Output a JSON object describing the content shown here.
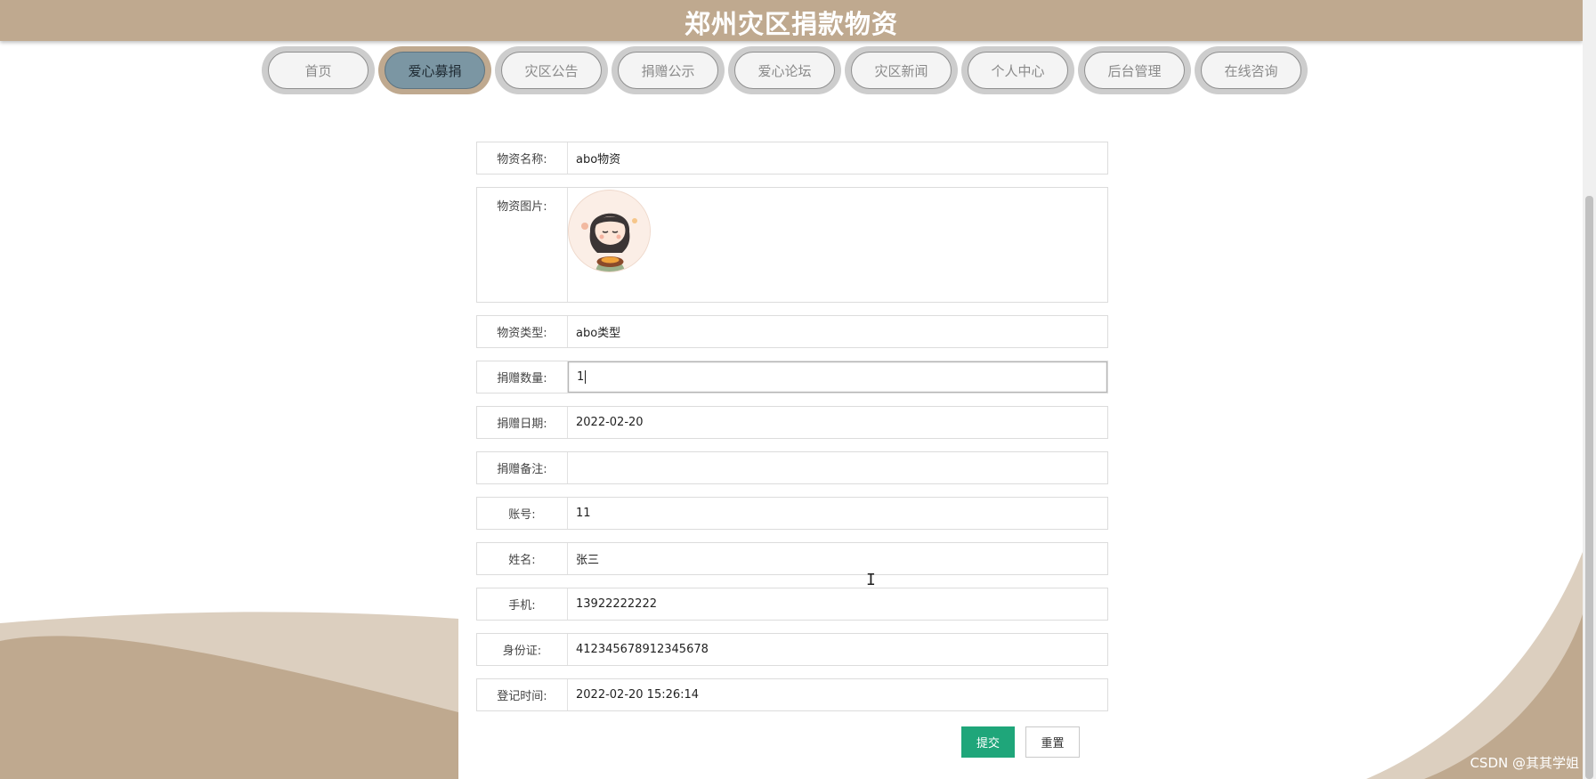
{
  "header": {
    "title": "郑州灾区捐款物资"
  },
  "nav": {
    "items": [
      {
        "label": "首页"
      },
      {
        "label": "爱心募捐"
      },
      {
        "label": "灾区公告"
      },
      {
        "label": "捐赠公示"
      },
      {
        "label": "爱心论坛"
      },
      {
        "label": "灾区新闻"
      },
      {
        "label": "个人中心"
      },
      {
        "label": "后台管理"
      },
      {
        "label": "在线咨询"
      }
    ],
    "active_label": "爱心募捐"
  },
  "form": {
    "name": {
      "label": "物资名称:",
      "value": "abo物资"
    },
    "image": {
      "label": "物资图片:",
      "icon": "avatar-image"
    },
    "type": {
      "label": "物资类型:",
      "value": "abo类型"
    },
    "quantity": {
      "label": "捐赠数量:",
      "value": "1"
    },
    "date": {
      "label": "捐赠日期:",
      "value": "2022-02-20"
    },
    "remark": {
      "label": "捐赠备注:",
      "value": ""
    },
    "account": {
      "label": "账号:",
      "value": "11"
    },
    "fullname": {
      "label": "姓名:",
      "value": "张三"
    },
    "phone": {
      "label": "手机:",
      "value": "13922222222"
    },
    "idcard": {
      "label": "身份证:",
      "value": "412345678912345678"
    },
    "regtime": {
      "label": "登记时间:",
      "value": "2022-02-20 15:26:14"
    }
  },
  "buttons": {
    "submit": "提交",
    "reset": "重置"
  },
  "watermark": "CSDN @其其学姐",
  "colors": {
    "header": "#bfa98f",
    "active_nav": "#7b96a3",
    "submit": "#1fa67a",
    "wave_dark": "#bfa98f",
    "wave_light": "#dccfbf"
  }
}
